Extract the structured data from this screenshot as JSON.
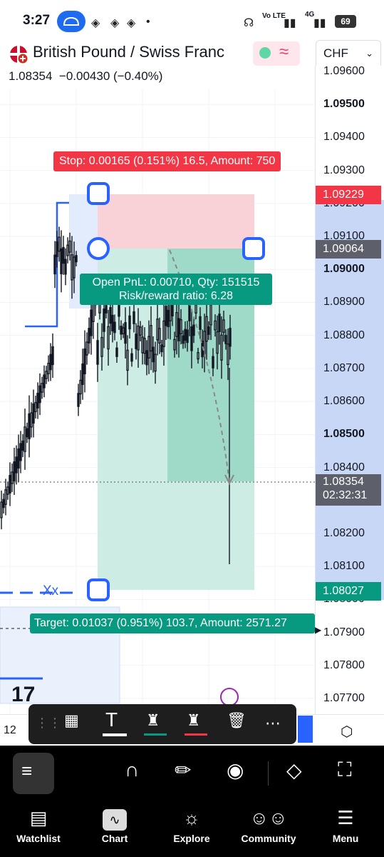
{
  "status_bar": {
    "time": "3:27",
    "signal": "4G",
    "battery": "69",
    "volte": "Vo LTE"
  },
  "header": {
    "symbol": "British Pound / Swiss Franc",
    "last": "1.08354",
    "change": "−0.00430 (−0.40%)",
    "currency": "CHF"
  },
  "price_axis": {
    "labels": [
      {
        "value": "1.09600",
        "bold": false
      },
      {
        "value": "1.09500",
        "bold": true
      },
      {
        "value": "1.09400",
        "bold": false
      },
      {
        "value": "1.09300",
        "bold": false
      },
      {
        "value": "1.09200",
        "bold": false
      },
      {
        "value": "1.09100",
        "bold": false
      },
      {
        "value": "1.09000",
        "bold": true
      },
      {
        "value": "1.08900",
        "bold": false
      },
      {
        "value": "1.08800",
        "bold": false
      },
      {
        "value": "1.08700",
        "bold": false
      },
      {
        "value": "1.08600",
        "bold": false
      },
      {
        "value": "1.08500",
        "bold": true
      },
      {
        "value": "1.08400",
        "bold": false
      },
      {
        "value": "1.08200",
        "bold": false
      },
      {
        "value": "1.08100",
        "bold": false
      },
      {
        "value": "1.08000",
        "bold": false
      },
      {
        "value": "1.07900",
        "bold": false
      },
      {
        "value": "1.07800",
        "bold": false
      },
      {
        "value": "1.07700",
        "bold": false
      }
    ],
    "stop_tag": "1.09229",
    "entry_tag": "1.09064",
    "current_tag": "1.08354",
    "countdown": "02:32:31",
    "target_tag": "1.08027",
    "stop_color": "#f23645",
    "target_color": "#089981"
  },
  "position": {
    "stop_label": "Stop: 0.00165 (0.151%) 16.5, Amount: 750",
    "pnl_line1": "Open PnL: 0.00710, Qty: 151515",
    "pnl_line2": "Risk/reward ratio: 6.28",
    "target_label": "Target: 0.01037 (0.951%) 103.7, Amount: 2571.27"
  },
  "chart": {
    "drawing_label": "Xx",
    "time_label": "12"
  },
  "floating_toolbar": {
    "items": [
      "object-tree-icon",
      "text-icon",
      "fill-color-icon",
      "line-color-icon",
      "delete-icon",
      "more-icon"
    ]
  },
  "toolbar": {
    "items": [
      "drawings-icon",
      "magnet-icon",
      "lock-drawing-icon",
      "eye-icon",
      "layers-icon",
      "fullscreen-icon"
    ]
  },
  "nav": {
    "items": [
      {
        "label": "Watchlist",
        "icon": "watchlist-icon"
      },
      {
        "label": "Chart",
        "icon": "chart-icon"
      },
      {
        "label": "Explore",
        "icon": "compass-icon"
      },
      {
        "label": "Community",
        "icon": "community-icon"
      },
      {
        "label": "Menu",
        "icon": "menu-icon"
      }
    ],
    "active": "Chart"
  }
}
